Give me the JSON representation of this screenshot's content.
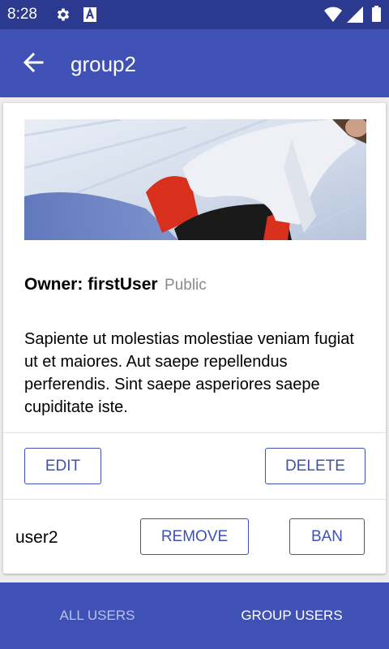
{
  "status_bar": {
    "time": "8:28",
    "icons": [
      "gear-icon",
      "a-badge-icon",
      "wifi-icon",
      "signal-icon",
      "battery-icon"
    ]
  },
  "app_bar": {
    "back_icon": "arrow-back-icon",
    "title": "group2"
  },
  "group_card": {
    "owner_label": "Owner: ",
    "owner_name": "firstUser",
    "visibility": "Public",
    "description": "Sapiente ut molestias molestiae veniam fugiat ut et maiores. Aut saepe repellendus perferendis. Sint saepe asperiores saepe cupiditate iste.",
    "edit_label": "EDIT",
    "delete_label": "DELETE"
  },
  "member": {
    "name": "user2",
    "remove_label": "REMOVE",
    "ban_label": "BAN"
  },
  "bottom_nav": {
    "tabs": [
      {
        "label": "ALL USERS",
        "active": false
      },
      {
        "label": "GROUP USERS",
        "active": true
      }
    ]
  },
  "colors": {
    "primary": "#3f51b5",
    "primary_dark": "#2b3a8f",
    "inactive_tab": "#b9c1ec",
    "secondary_text": "#8a8a8a"
  }
}
